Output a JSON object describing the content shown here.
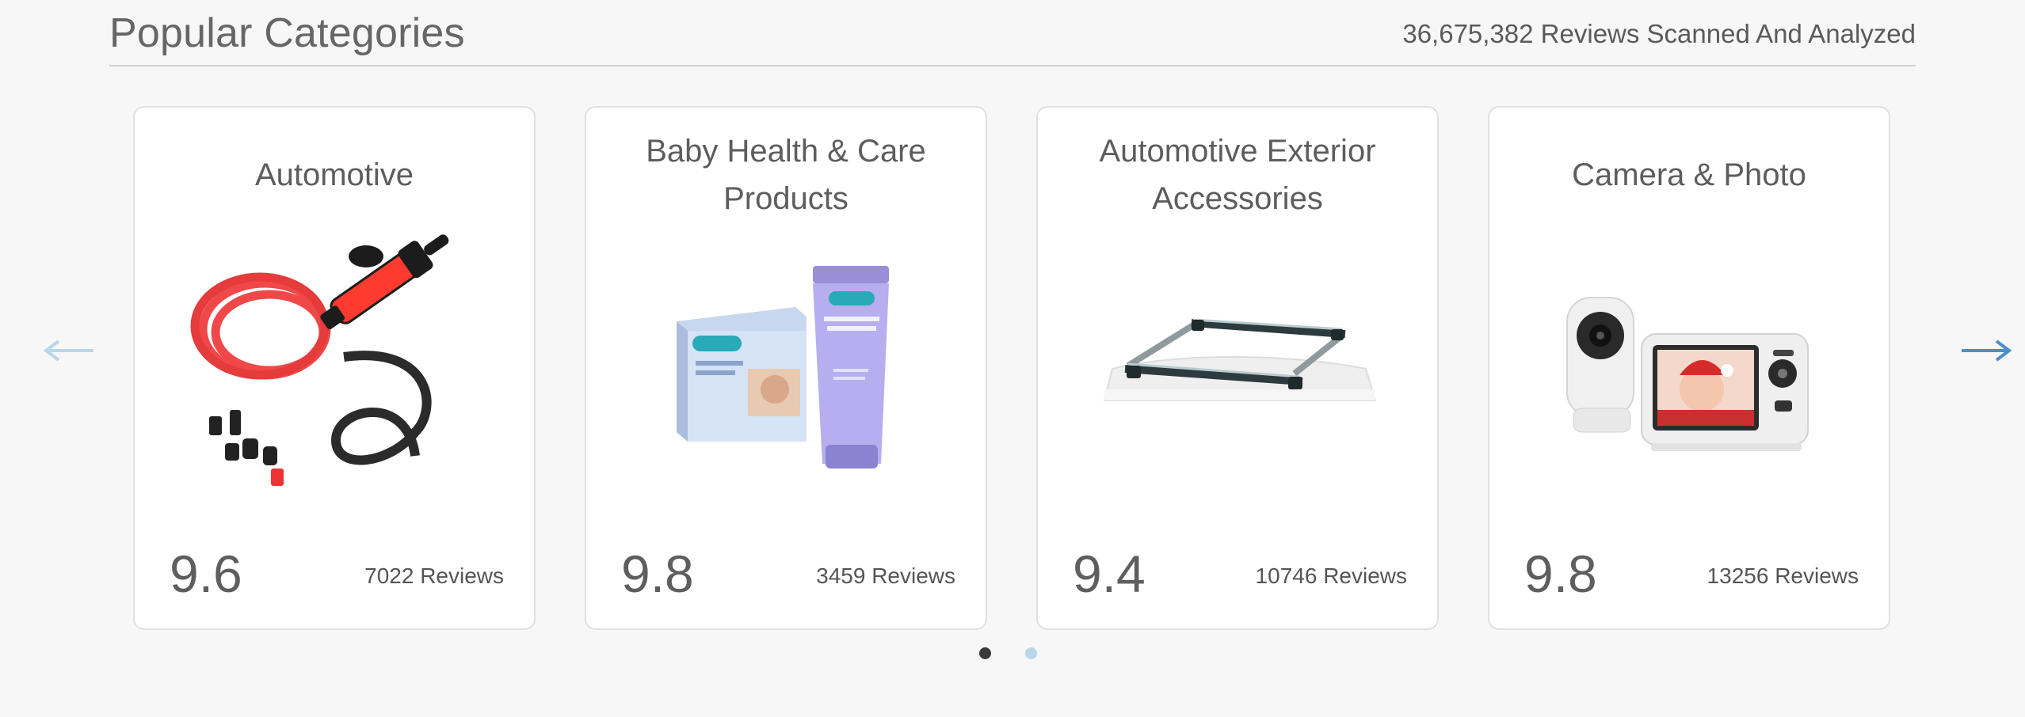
{
  "header": {
    "title": "Popular Categories",
    "stats": "36,675,382 Reviews Scanned And Analyzed"
  },
  "carousel": {
    "prev_icon": "arrow-left-icon",
    "next_icon": "arrow-right-icon",
    "cards": [
      {
        "title": "Automotive",
        "image": "fuel-siphon-pump-image",
        "score": "9.6",
        "reviews": "7022 Reviews"
      },
      {
        "title": "Baby Health & Care Products",
        "image": "lanolin-cream-image",
        "score": "9.8",
        "reviews": "3459 Reviews"
      },
      {
        "title": "Automotive Exterior Accessories",
        "image": "roof-rack-crossbars-image",
        "score": "9.4",
        "reviews": "10746 Reviews"
      },
      {
        "title": "Camera & Photo",
        "image": "baby-monitor-image",
        "score": "9.8",
        "reviews": "13256 Reviews"
      }
    ],
    "pagination": {
      "pages": 2,
      "current": 1
    }
  },
  "colors": {
    "background": "#f7f7f7",
    "card": "#ffffff",
    "arrow_active": "#4a90c9",
    "arrow_inactive": "#b9d6ea",
    "dot_active": "#3a3a3a",
    "dot_inactive": "#b9d6ea"
  }
}
